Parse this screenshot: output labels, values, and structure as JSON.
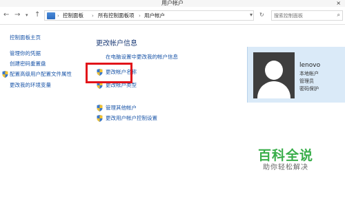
{
  "window": {
    "title": "用户帐户",
    "close_glyph": "×"
  },
  "address": {
    "crumbs": [
      "控制面板",
      "所有控制面板项",
      "用户帐户"
    ],
    "search_placeholder": "搜索控制面板"
  },
  "sidebar": {
    "items": [
      "控制面板主页",
      "管理你的凭据",
      "创建密码重置盘",
      "配置高级用户配置文件属性",
      "更改我的环境变量"
    ]
  },
  "main": {
    "heading": "更改帐户信息",
    "links": [
      "在电脑设置中更改我的帐户信息",
      "更改帐户名称",
      "更改帐户类型",
      "管理其他帐户",
      "更改用户帐户控制设置"
    ]
  },
  "account": {
    "name": "lenovo",
    "details": [
      "本地帐户",
      "管理员",
      "密码保护"
    ]
  },
  "watermark": {
    "title": "百科全说",
    "subtitle": "助你轻松解决"
  },
  "colors": {
    "link": "#1a55a8",
    "highlight": "#e2141a",
    "panel": "#daeaf8",
    "brand": "#39ae4a"
  }
}
